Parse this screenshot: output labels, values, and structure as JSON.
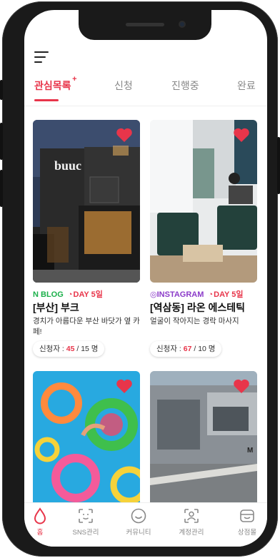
{
  "colors": {
    "accent": "#e8354a",
    "blog": "#1bb04a",
    "instagram": "#8b3bc9"
  },
  "menu_icon": "hamburger-menu-icon",
  "tabs": [
    {
      "label": "관심목록",
      "badge": "+"
    },
    {
      "label": "신청"
    },
    {
      "label": "진행중"
    },
    {
      "label": "완료"
    }
  ],
  "campaigns": [
    {
      "source": "BLOG",
      "source_icon": "naver-n-icon",
      "day": "DAY 5일",
      "title": "[부산] 부크",
      "desc": "경치가 아름다운 부산 바닷가 옆 카페!",
      "applicant_label": "신청자 :",
      "applied": "45",
      "sep": " / ",
      "capacity": "15",
      "unit": " 명",
      "liked": true
    },
    {
      "source": "INSTAGRAM",
      "source_icon": "instagram-icon",
      "day": "DAY 5일",
      "title": "[역삼동] 라온 에스테틱",
      "desc": "얼굴이 작아지는 경락 마사지",
      "applicant_label": "신청자 :",
      "applied": "67",
      "sep": " / ",
      "capacity": "10",
      "unit": " 명",
      "liked": true
    },
    {
      "liked": true
    },
    {
      "liked": true
    }
  ],
  "bottom_nav": [
    {
      "label": "홈",
      "icon": "home-drop-icon"
    },
    {
      "label": "SNS관리",
      "icon": "scan-face-icon"
    },
    {
      "label": "커뮤니티",
      "icon": "smile-icon"
    },
    {
      "label": "계정관리",
      "icon": "user-scan-icon"
    },
    {
      "label": "상점몰",
      "icon": "shop-icon"
    }
  ]
}
